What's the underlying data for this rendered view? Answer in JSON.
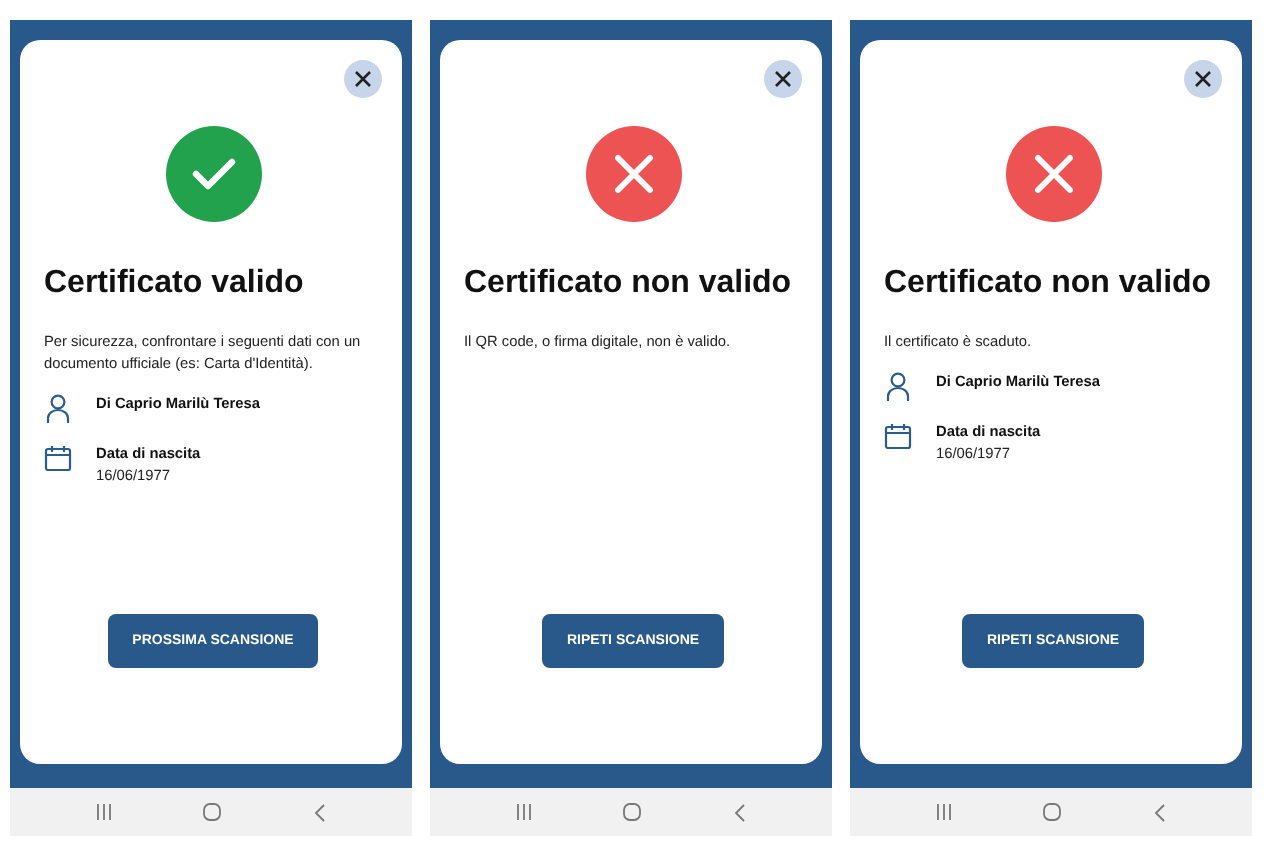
{
  "screens": [
    {
      "kind": "valid",
      "title": "Certificato valido",
      "message": "Per sicurezza, confrontare i seguenti dati con un documento ufficiale (es: Carta d'Identità).",
      "details": [
        {
          "kind": "person",
          "label": "Di Caprio Marilù Teresa"
        },
        {
          "kind": "date",
          "label": "Data di nascita",
          "value": "16/06/1977"
        }
      ],
      "button": "PROSSIMA SCANSIONE"
    },
    {
      "kind": "invalid",
      "title": "Certificato non valido",
      "message": "Il QR code, o firma digitale, non è valido.",
      "button": "RIPETI SCANSIONE"
    },
    {
      "kind": "invalid",
      "title": "Certificato non valido",
      "message": "Il certificato è scaduto.",
      "details": [
        {
          "kind": "person",
          "label": "Di Caprio Marilù Teresa"
        },
        {
          "kind": "date",
          "label": "Data di nascita",
          "value": "16/06/1977"
        }
      ],
      "button": "RIPETI SCANSIONE"
    }
  ]
}
